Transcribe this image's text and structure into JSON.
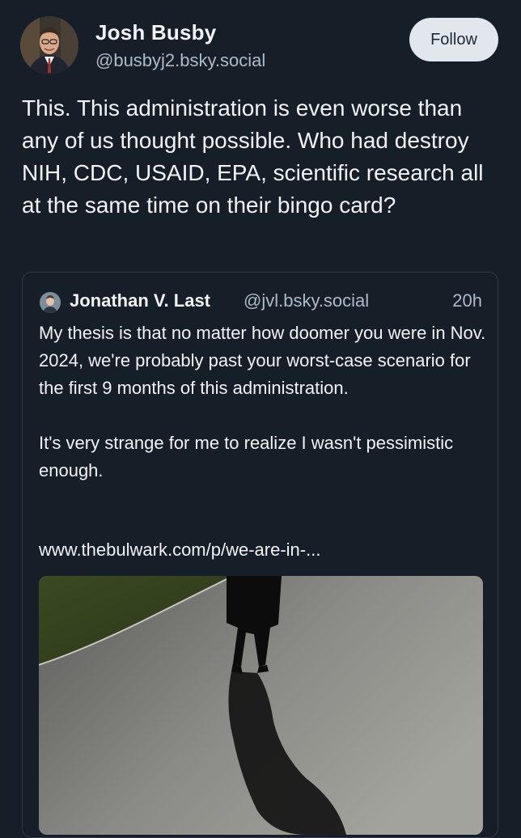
{
  "post": {
    "author_name": "Josh Busby",
    "author_handle": "@busbyj2.bsky.social",
    "follow_label": "Follow",
    "text": "This. This administration is even worse than any of us thought possible. Who had destroy NIH, CDC, USAID, EPA, scientific research all at the same time on their bingo card?"
  },
  "quote": {
    "author_name": "Jonathan V. Last",
    "author_handle": "@jvl.bsky.social",
    "time": "20h",
    "paragraph1": "My thesis is that no matter how doomer you were in Nov. 2024, we're probably past your worst-case scenario for the first 9 months of this administration.",
    "paragraph2": "It's very strange for me to realize I wasn't pessimistic enough.",
    "link": "www.thebulwark.com/p/we-are-in-..."
  },
  "colors": {
    "background": "#161e27",
    "text": "#f1f3f5",
    "muted": "#aebbc9",
    "follow_bg": "#e2e7ee",
    "border": "#2e3a47"
  }
}
